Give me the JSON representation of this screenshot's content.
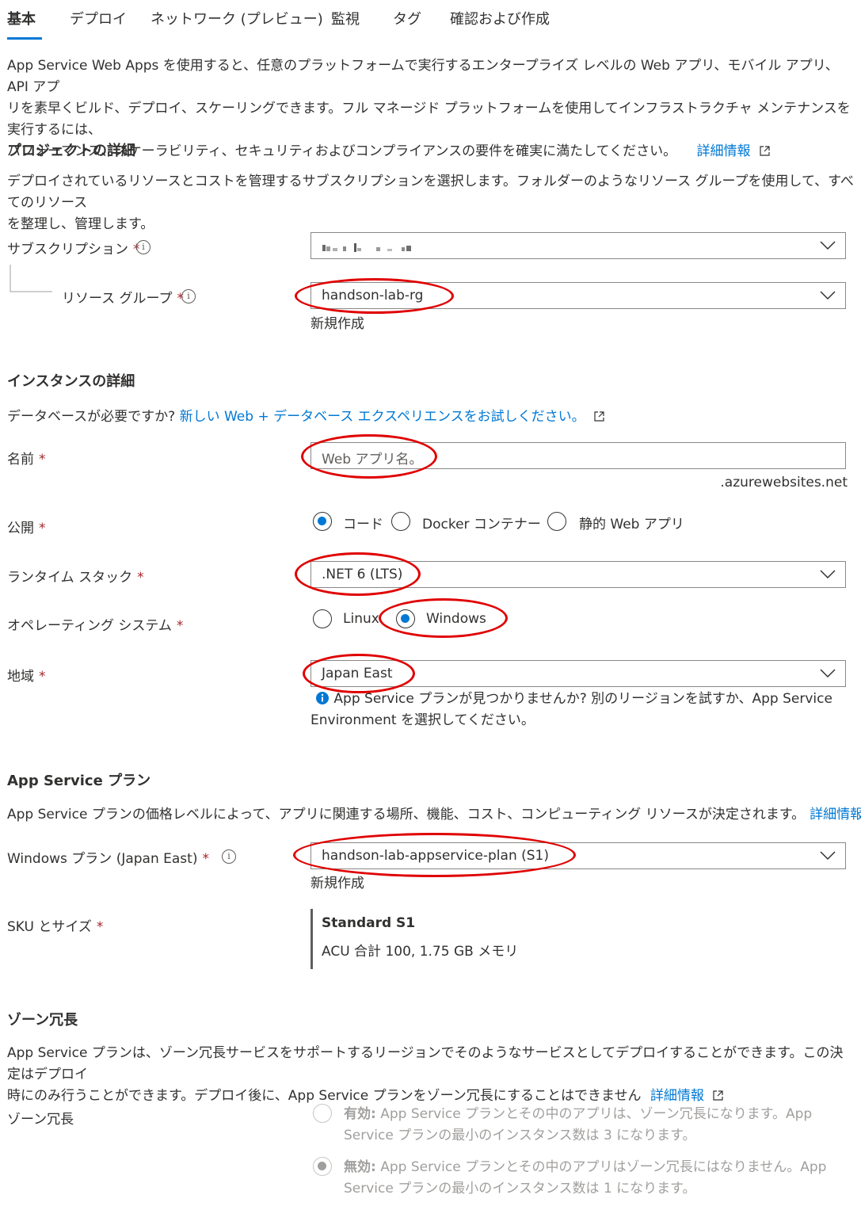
{
  "tabs": {
    "basics": "基本",
    "deploy": "デプロイ",
    "network": "ネットワーク (プレビュー)",
    "monitoring": "監視",
    "tags": "タグ",
    "review": "確認および作成"
  },
  "intro": {
    "line1": "App Service Web Apps を使用すると、任意のプラットフォームで実行するエンタープライズ レベルの Web アプリ、モバイル アプリ、API アプ",
    "line2": "リを素早くビルド、デプロイ、スケーリングできます。フル マネージド プラットフォームを使用してインフラストラクチャ メンテナンスを実行するには、",
    "line3": "パフォーマンス、スケーラビリティ、セキュリティおよびコンプライアンスの要件を確実に満たしてください。",
    "link": "詳細情報"
  },
  "project": {
    "heading": "プロジェクトの詳細",
    "desc_line1": "デプロイされているリソースとコストを管理するサブスクリプションを選択します。フォルダーのようなリソース グループを使用して、すべてのリソース",
    "desc_line2": "を整理し、管理します。",
    "subscription_label": "サブスクリプション",
    "resource_group_label": "リソース グループ",
    "resource_group_value": "handson-lab-rg",
    "create_new": "新規作成"
  },
  "instance": {
    "heading": "インスタンスの詳細",
    "db_prompt": "データベースが必要ですか?",
    "db_link": "新しい Web + データベース エクスペリエンスをお試しください。",
    "name_label": "名前",
    "name_placeholder": "Web アプリ名。",
    "name_suffix": ".azurewebsites.net",
    "publish_label": "公開",
    "publish_code": "コード",
    "publish_docker": "Docker コンテナー",
    "publish_static": "静的 Web アプリ",
    "runtime_label": "ランタイム スタック",
    "runtime_value": ".NET 6 (LTS)",
    "os_label": "オペレーティング システム",
    "os_linux": "Linux",
    "os_windows": "Windows",
    "region_label": "地域",
    "region_value": "Japan East",
    "region_info_line1": "App Service プランが見つかりませんか? 別のリージョンを試すか、App Service",
    "region_info_line2": "Environment を選択してください。"
  },
  "plan": {
    "heading": "App Service プラン",
    "desc": "App Service プランの価格レベルによって、アプリに関連する場所、機能、コスト、コンピューティング リソースが決定されます。",
    "link": "詳細情報",
    "windows_plan_label": "Windows プラン (Japan East)",
    "windows_plan_value": "handson-lab-appservice-plan (S1)",
    "create_new": "新規作成",
    "sku_label": "SKU とサイズ",
    "sku_name": "Standard S1",
    "sku_detail": "ACU 合計 100, 1.75 GB メモリ"
  },
  "zone": {
    "heading": "ゾーン冗長",
    "desc_line1": "App Service プランは、ゾーン冗長サービスをサポートするリージョンでそのようなサービスとしてデプロイすることができます。この決定はデプロイ",
    "desc_line2": "時にのみ行うことができます。デプロイ後に、App Service プランをゾーン冗長にすることはできません",
    "link": "詳細情報",
    "label": "ゾーン冗長",
    "enabled_title": "有効:",
    "enabled_line1": "App Service プランとその中のアプリは、ゾーン冗長になります。App",
    "enabled_line2": "Service プランの最小のインスタンス数は 3 になります。",
    "disabled_title": "無効:",
    "disabled_line1": "App Service プランとその中のアプリはゾーン冗長にはなりません。App",
    "disabled_line2": "Service プランの最小のインスタンス数は 1 になります。"
  },
  "colors": {
    "accent": "#0078d4",
    "required": "#a4262c",
    "annotation": "#e00000"
  }
}
